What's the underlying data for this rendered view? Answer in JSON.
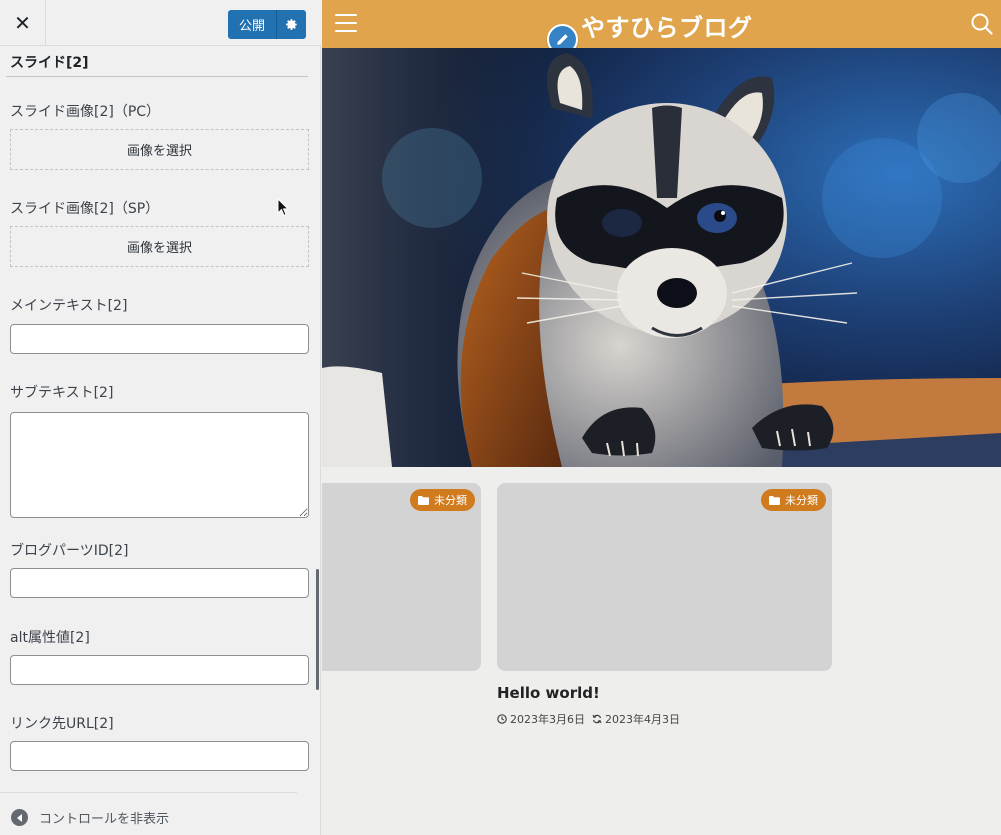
{
  "customizer": {
    "close_label": "✕",
    "publish_label": "公開",
    "section_title": "スライド[2]",
    "controls": {
      "image_pc_label": "スライド画像[2]（PC）",
      "image_sp_label": "スライド画像[2]（SP）",
      "select_image_label": "画像を選択",
      "main_text_label": "メインテキスト[2]",
      "main_text_value": "",
      "sub_text_label": "サブテキスト[2]",
      "sub_text_value": "",
      "blog_parts_label": "ブログパーツID[2]",
      "blog_parts_value": "",
      "alt_label": "alt属性値[2]",
      "alt_value": "",
      "link_label": "リンク先URL[2]",
      "link_value": ""
    },
    "collapse_label": "コントロールを非表示"
  },
  "preview": {
    "site_title": "やすひらブログ",
    "header_color": "#e0a54c",
    "cards": [
      {
        "category": "未分類"
      },
      {
        "category": "未分類"
      }
    ],
    "post": {
      "title": "Hello world!",
      "published": "2023年3月6日",
      "modified": "2023年4月3日"
    }
  }
}
